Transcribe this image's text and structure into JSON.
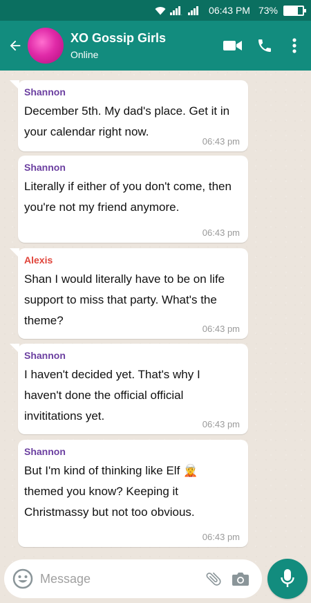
{
  "status_bar": {
    "time": "06:43 PM",
    "battery": "73%",
    "battery_level": 0.73
  },
  "header": {
    "title": "XO Gossip Girls",
    "subtitle": "Online",
    "icons": [
      "back-arrow-icon",
      "video-call-icon",
      "phone-call-icon",
      "more-vert-icon"
    ]
  },
  "messages": [
    {
      "sender": "Shannon",
      "sender_color": "#6b3fa0",
      "text": " December 5th. My dad's place. Get it in your calendar right now.",
      "time": "06:43 pm"
    },
    {
      "sender": "Shannon",
      "sender_color": "#6b3fa0",
      "text": " Literally if either of you don't come, then you're not my friend anymore.",
      "time": "06:43 pm"
    },
    {
      "sender": "Alexis",
      "sender_color": "#e0443a",
      "text": " Shan I would literally have to be on life support to miss that party. What's the theme?",
      "time": "06:43 pm"
    },
    {
      "sender": "Shannon",
      "sender_color": "#6b3fa0",
      "text": " I haven't decided yet. That's why I haven't done the official official invititations yet.",
      "time": "06:43 pm"
    },
    {
      "sender": "Shannon",
      "sender_color": "#6b3fa0",
      "text": " But I'm kind of thinking like Elf 🧝 themed you know? Keeping it Christmassy but not too obvious.",
      "time": "06:43 pm"
    }
  ],
  "input": {
    "placeholder": "Message"
  },
  "colors": {
    "header": "#128c7e",
    "status_bar": "#0b6f60",
    "background": "#ece5dd"
  }
}
